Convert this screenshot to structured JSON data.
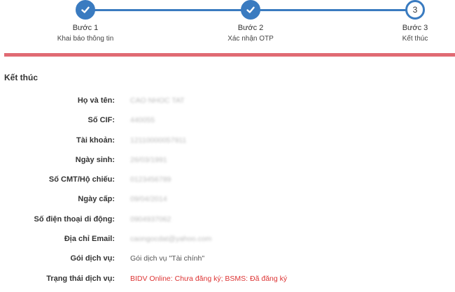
{
  "steps": [
    {
      "title": "Bước 1",
      "subtitle": "Khai báo thông tin",
      "state": "done"
    },
    {
      "title": "Bước 2",
      "subtitle": "Xác nhận OTP",
      "state": "done"
    },
    {
      "title": "Bước 3",
      "subtitle": "Kết thúc",
      "state": "current",
      "number": "3"
    }
  ],
  "colors": {
    "accent": "#3a7bc0",
    "divider": "#e06a73",
    "status_text": "#d33333"
  },
  "section_title": "Kết thúc",
  "info": {
    "full_name": {
      "label": "Họ và tên:",
      "value": "CAO NHOC TAT"
    },
    "cif": {
      "label": "Số CIF:",
      "value": "440055"
    },
    "account": {
      "label": "Tài khoản:",
      "value": "12110000057911"
    },
    "dob": {
      "label": "Ngày sinh:",
      "value": "26/03/1991"
    },
    "id_number": {
      "label": "Số CMT/Hộ chiếu:",
      "value": "0123456789"
    },
    "issue_date": {
      "label": "Ngày cấp:",
      "value": "09/04/2014"
    },
    "phone": {
      "label": "Số điện thoại di động:",
      "value": "0904937062"
    },
    "email": {
      "label": "Địa chỉ Email:",
      "value": "caongocdat@yahoo.com"
    },
    "package": {
      "label": "Gói dịch vụ:",
      "value": "Gói dịch vụ \"Tài chính\""
    },
    "status": {
      "label": "Trạng thái dịch vụ:",
      "value": "BIDV Online: Chưa đăng ký; BSMS: Đã đăng ký"
    }
  }
}
